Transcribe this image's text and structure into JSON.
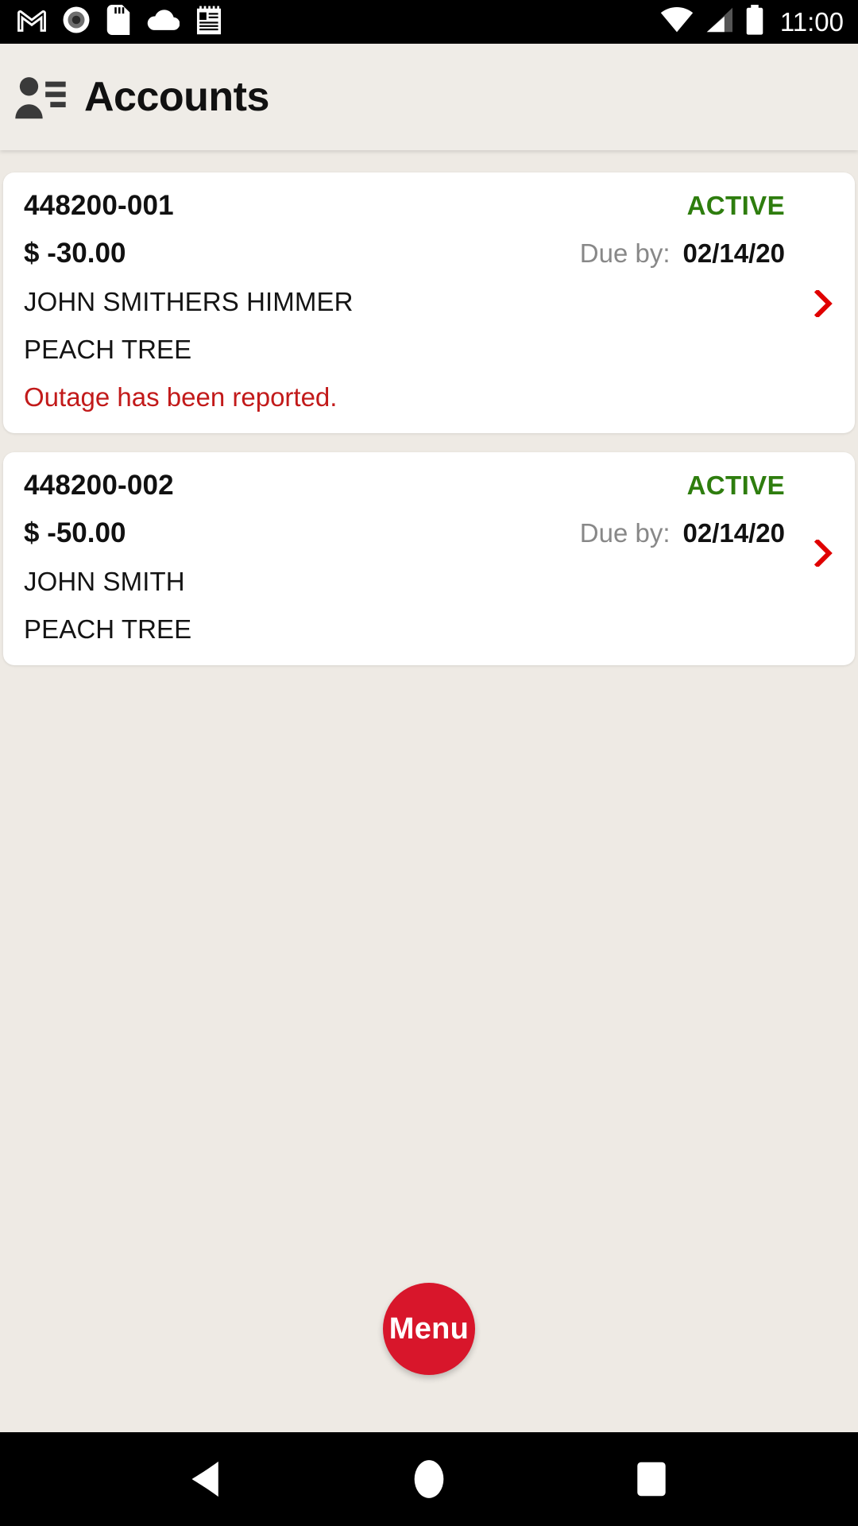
{
  "status_bar": {
    "time": "11:00",
    "left_icons": [
      {
        "name": "gmail-icon",
        "label": "M"
      },
      {
        "name": "screen-record-icon",
        "label": "record"
      },
      {
        "name": "sd-card-icon",
        "label": "sd card"
      },
      {
        "name": "cloud-icon",
        "label": "cloud"
      },
      {
        "name": "notes-icon",
        "label": "notes"
      }
    ],
    "right_icons": [
      {
        "name": "wifi-icon",
        "label": "wifi full"
      },
      {
        "name": "cellular-signal-icon",
        "label": "signal"
      },
      {
        "name": "battery-icon",
        "label": "battery full"
      }
    ]
  },
  "app_bar": {
    "title": "Accounts",
    "icon": "accounts-contacts-icon"
  },
  "accounts": [
    {
      "id": "448200-001",
      "status": "ACTIVE",
      "amount": "$ -30.00",
      "due_label": "Due by:",
      "due_date": "02/14/20",
      "customer_name": "JOHN SMITHERS HIMMER",
      "location": "PEACH TREE",
      "notice": "Outage has been reported."
    },
    {
      "id": "448200-002",
      "status": "ACTIVE",
      "amount": "$ -50.00",
      "due_label": "Due by:",
      "due_date": "02/14/20",
      "customer_name": "JOHN SMITH",
      "location": "PEACH TREE",
      "notice": ""
    }
  ],
  "fab": {
    "label": "Menu"
  },
  "nav_bar": {
    "back": "back-button",
    "home": "home-button",
    "recents": "recents-button"
  },
  "colors": {
    "page_background": "#EEEAE4",
    "app_bar_background": "#EFECE7",
    "card_background": "#FFFFFF",
    "status_active": "#2E7D0E",
    "notice_red": "#C21A1A",
    "chevron_red": "#E00000",
    "fab_red": "#D8162B",
    "due_label_gray": "#888888"
  }
}
